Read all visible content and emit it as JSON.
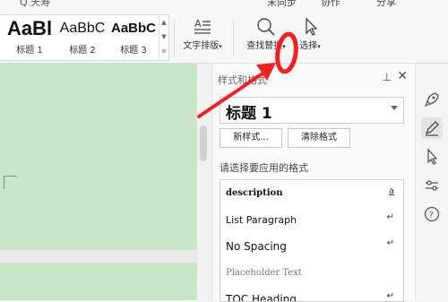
{
  "top": {
    "search_text": "Q 天寿",
    "sync_text": "未同步",
    "collab_text": "协作",
    "share_text": "分享"
  },
  "ribbon": {
    "styles": [
      {
        "sample": "AaBl",
        "name": "标题 1"
      },
      {
        "sample": "AaBbC",
        "name": "标题 2"
      },
      {
        "sample": "AaBbC",
        "name": "标题 3"
      }
    ],
    "text_layout_label": "文字排版",
    "find_replace_label": "查找替换",
    "select_label": "选择"
  },
  "pane": {
    "title": "样式和格式",
    "current_style": "标题  1",
    "new_style_label": "新样式...",
    "clear_format_label": "清除格式",
    "apply_label": "请选择要应用的格式",
    "styles": [
      {
        "name": "description",
        "mark": "a"
      },
      {
        "name": "List Paragraph",
        "mark": "↵"
      },
      {
        "name": "No Spacing",
        "mark": "↵"
      },
      {
        "name": "Placeholder Text",
        "mark": ""
      },
      {
        "name": "TOC Heading",
        "mark": "↵"
      }
    ]
  },
  "colors": {
    "document_bg": "#c9e7c8",
    "annotation": "#ee2222"
  }
}
